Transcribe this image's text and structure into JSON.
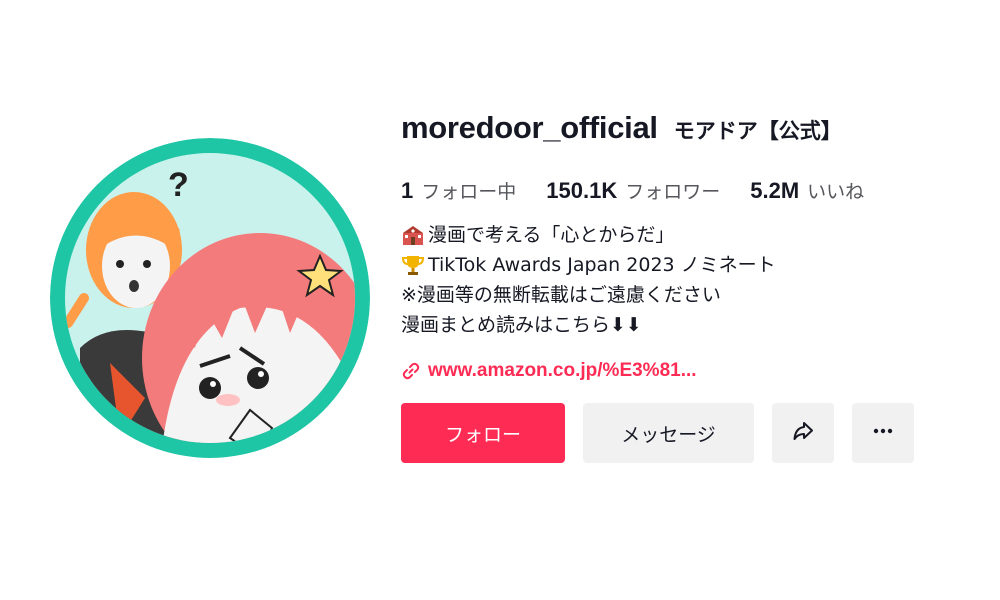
{
  "profile": {
    "username": "moredoor_official",
    "nickname": "モアドア【公式】",
    "avatar": "avatar-illustration"
  },
  "stats": {
    "following": {
      "value": "1",
      "label": "フォロー中"
    },
    "followers": {
      "value": "150.1K",
      "label": "フォロワー"
    },
    "likes": {
      "value": "5.2M",
      "label": "いいね"
    }
  },
  "bio": {
    "line1": {
      "emoji": "school-icon",
      "text": "漫画で考える「心とからだ」"
    },
    "line2": {
      "emoji": "trophy-icon",
      "text": "TikTok Awards Japan 2023 ノミネート"
    },
    "line3": {
      "text": "※漫画等の無断転載はご遠慮ください"
    },
    "line4": {
      "text": "漫画まとめ読みはこちら⬇⬇"
    }
  },
  "link": {
    "icon": "link-icon",
    "text": "www.amazon.co.jp/%E3%81..."
  },
  "actions": {
    "follow_label": "フォロー",
    "message_label": "メッセージ",
    "share_icon": "share-icon",
    "more_icon": "more-icon"
  },
  "colors": {
    "brand": "#fe2c55",
    "button_gray": "#f1f1f2",
    "avatar_ring": "#1fc6a6",
    "avatar_bg": "#c9f2ec"
  }
}
